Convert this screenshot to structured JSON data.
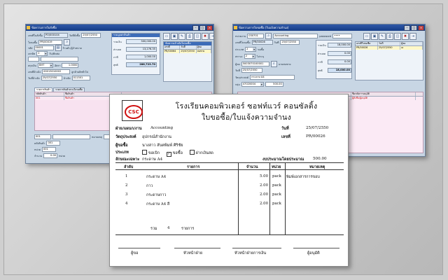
{
  "left_window": {
    "title": "ข้อความการใบสั่งซื้อ",
    "fields": {
      "po_no_label": "เลขที่ใบสั่งซื้อ",
      "po_no": "PO/000104",
      "date_label": "วันที่สั่งซื้อ",
      "date": "25/07/2550",
      "pr_label": "ใบขอซื้อ",
      "pr_no": "PR/00019",
      "code_label": "รหัส",
      "code": "00001",
      "supplier_btn": "ร้านค้า/ผู้จำหน่าย",
      "credit_label": "เครดิต",
      "credit": "2",
      "credit_unit": "วัน/ติดต่อ",
      "currency_label": "สกุลเงิน",
      "currency": "BHT",
      "rate_label": "อัตรา",
      "rate": "1.0000",
      "order_no_label": "เลขที่อ้างอิง",
      "order_no": "00013010002",
      "order_name": "ลูกค้าผลิตทั่วไป",
      "ref_date_label": "วันที่อ้างอิง",
      "ref_date": "25/07/2550",
      "ref2_label": "อ้างอิง",
      "ref2": "011301"
    },
    "summary": {
      "header": "รวมมูลค่าสินค้า",
      "total_label": "รวมเงิน",
      "total": "300,000.00",
      "discount_label": "ส่วนลด",
      "discount": "13,276.35",
      "vat_label": "ภาษี",
      "vat": "1,000.00",
      "net_label": "สุทธิ",
      "net": "286,723.70"
    },
    "ref_pane": {
      "header": "ข้อความอ้างอิงใบขอซื้อ",
      "columns": [
        "เลขที่",
        "วันที่",
        "ผู้ขอ"
      ],
      "rows": [
        [
          "PR/00064",
          "25/07/2550",
          "สมชาย"
        ]
      ]
    },
    "tabs": [
      "รายการสินค้า",
      "รายการสินค้าตามใบขอซื้อ"
    ],
    "grid_columns": [
      "รหัสสินค้า",
      "ชื่อสินค้า"
    ],
    "grid_first_code": "001",
    "grid_first_name": "ชื่อสินค้า",
    "bottom": {
      "code": "001",
      "note_label": "หมายเหตุ",
      "loc_label": "คลังสินค้า",
      "loc": "001",
      "unit_label": "หน่วย",
      "unit": "001",
      "qty_label": "จำนวน",
      "qty": "0.00",
      "unit2_label": "หน่วย"
    }
  },
  "right_window": {
    "title": "ข้อความการใบขอซื้อ (ใบแจ้งความจำนง)",
    "fields": {
      "dept_label": "หน่วยงาน",
      "dept_code": "030701",
      "dept_name": "Accounting",
      "password_label": "password",
      "password": "••••",
      "pr_label": "เลขที่ใบขอซื้อ",
      "pr_no": "PR/00026",
      "date_label": "วันที่",
      "date": "25/07/2550",
      "type_label": "ประเภท",
      "type": "2",
      "type_name": "ขอซื้อ",
      "status_label": "สถานะ",
      "status": "2",
      "status_name": "ไม่ระบุ",
      "req_label": "ผู้ขอ",
      "req_code": "5003070100001",
      "req_name": "นายสมชาย",
      "req_date_label": "วันที่",
      "req_date": "25/07/2550",
      "purpose_label": "วัตถุประสงค์",
      "purpose": "กระดาษ A4",
      "group_label": "กลุ่ม",
      "group": "47020004",
      "amount": "500.00"
    },
    "summary": {
      "total_label": "รวมเงิน",
      "total": "18,000.00",
      "discount_label": "ส่วนลด",
      "discount": "0.00",
      "vat_label": "ภาษี",
      "vat": "0.00",
      "net_label": "สุทธิ",
      "net": "18,000.00"
    },
    "ref_pane": {
      "columns": [
        "เลขที่ใบขอซื้อ",
        "วันที่",
        "ผู้ขอ"
      ],
      "rows": [
        [
          "PR/00026",
          "25/07/2550",
          "เอ"
        ]
      ]
    },
    "grid_header": "ชื่อหลังการอนุมัติ",
    "grid_first": "ผู้สั่งซื้อ/ผู้อนุมัติ"
  },
  "document": {
    "logo_text": "CSC",
    "company": "โรงเรียนคอมพิวเตอร์ ซอฟท์แวร์ คอนซัลติ้ง",
    "title": "ใบขอซื้อ/ใบแจ้งความจำนง",
    "dept_label": "ฝ่าย/แผนก/งาน",
    "dept": "Accounting",
    "date_label": "วันที่",
    "date": "25/07/2550",
    "purpose_label": "วัตถุประสงค์",
    "purpose": "อุปกรณ์สำนักงาน",
    "no_label": "เลขที่",
    "no": "PR/00026",
    "req_label": "ผู้ขอซื้อ",
    "req": "นางสาว สันตพิมพ์ ศิริชัย",
    "type_label": "ประเภท",
    "options": [
      {
        "label": "ขอเบิก",
        "checked": false
      },
      {
        "label": "ขอซื้อ",
        "checked": true
      },
      {
        "label": "ฝากเงินสด",
        "checked": false
      }
    ],
    "detail_label": "ลักษณะเฉพาะ",
    "detail": "กระดาษ A4",
    "est_label": "งบประมาณโดยประมาณ",
    "est": "500.00",
    "columns": [
      "ลำดับ",
      "รายการ",
      "จำนวน",
      "หน่วย",
      "หมายเหตุ"
    ],
    "items": [
      {
        "no": "1",
        "name": "กระดาษ A4",
        "qty": "5.00",
        "unit": "pack",
        "note": "พิมพ์เอกสารการขอบ"
      },
      {
        "no": "2",
        "name": "กาว",
        "qty": "2.00",
        "unit": "pack",
        "note": ""
      },
      {
        "no": "3",
        "name": "กระดาษกาว",
        "qty": "2.00",
        "unit": "pack",
        "note": ""
      },
      {
        "no": "4",
        "name": "กระดาษ A4 สี",
        "qty": "2.00",
        "unit": "pack",
        "note": ""
      }
    ],
    "total_label": "รวม",
    "total_count": "4",
    "total_unit": "รายการ",
    "signatures": [
      "ผู้ขอ",
      "หัวหน้าฝ่าย",
      "หัวหน้าฝ่ายการเงิน",
      "ผู้อนุมัติ"
    ]
  }
}
